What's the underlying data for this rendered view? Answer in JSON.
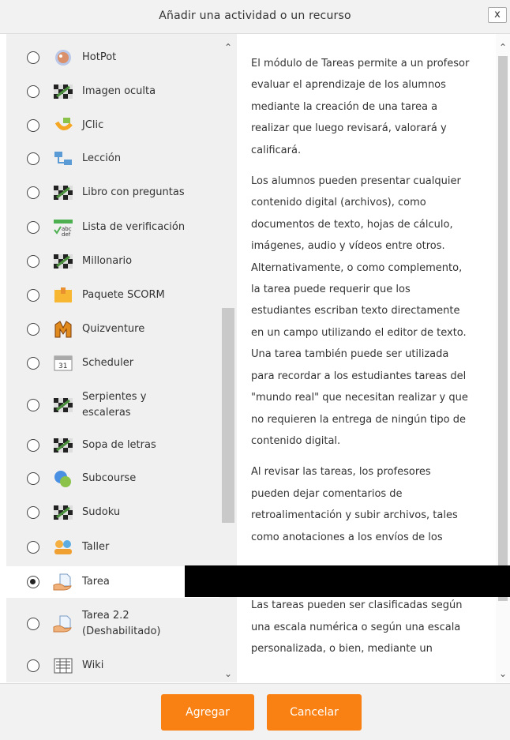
{
  "dialog": {
    "title": "Añadir una actividad o un recurso",
    "close_label": "x"
  },
  "activities": [
    {
      "label": "HotPot",
      "icon": "hotpot-icon",
      "selected": false
    },
    {
      "label": "Imagen oculta",
      "icon": "game-icon",
      "selected": false
    },
    {
      "label": "JClic",
      "icon": "jclic-icon",
      "selected": false
    },
    {
      "label": "Lección",
      "icon": "lesson-icon",
      "selected": false
    },
    {
      "label": "Libro con preguntas",
      "icon": "game-icon",
      "selected": false
    },
    {
      "label": "Lista de verificación",
      "icon": "checklist-icon",
      "selected": false
    },
    {
      "label": "Millonario",
      "icon": "game-icon",
      "selected": false
    },
    {
      "label": "Paquete SCORM",
      "icon": "scorm-icon",
      "selected": false
    },
    {
      "label": "Quizventure",
      "icon": "quizventure-icon",
      "selected": false
    },
    {
      "label": "Scheduler",
      "icon": "calendar-icon",
      "selected": false
    },
    {
      "label": "Serpientes y escaleras",
      "icon": "game-icon",
      "selected": false
    },
    {
      "label": "Sopa de letras",
      "icon": "game-icon",
      "selected": false
    },
    {
      "label": "Subcourse",
      "icon": "subcourse-icon",
      "selected": false
    },
    {
      "label": "Sudoku",
      "icon": "game-icon",
      "selected": false
    },
    {
      "label": "Taller",
      "icon": "workshop-icon",
      "selected": false
    },
    {
      "label": "Tarea",
      "icon": "assignment-icon",
      "selected": true
    },
    {
      "label": "Tarea 2.2 (Deshabilitado)",
      "icon": "assignment-icon",
      "selected": false
    },
    {
      "label": "Wiki",
      "icon": "wiki-icon",
      "selected": false
    }
  ],
  "description": {
    "p1": "El módulo de Tareas permite a un profesor evaluar el aprendizaje de los alumnos mediante la creación de una tarea a realizar que luego revisará, valorará y calificará.",
    "p2": "Los alumnos pueden presentar cualquier contenido digital (archivos), como documentos de texto, hojas de cálculo, imágenes, audio y vídeos entre otros. Alternativamente, o como complemento, la tarea puede requerir que los estudiantes escriban texto directamente en un campo utilizando el editor de texto. Una tarea también puede ser utilizada para recordar a los estudiantes tareas del \"mundo real\" que necesitan realizar y que no requieren la entrega de ningún tipo de contenido digital.",
    "p3": "Al revisar las tareas, los profesores pueden dejar comentarios de retroalimentación y subir archivos, tales como anotaciones a los envíos de los",
    "p3b": "observaciones o comentarios en audio. Las tareas pueden ser clasificadas según una escala numérica o según una escala personalizada, o bien, mediante un"
  },
  "footer": {
    "add_label": "Agregar",
    "cancel_label": "Cancelar"
  },
  "colors": {
    "accent": "#f98012",
    "panel_bg": "#f0f0f0"
  }
}
